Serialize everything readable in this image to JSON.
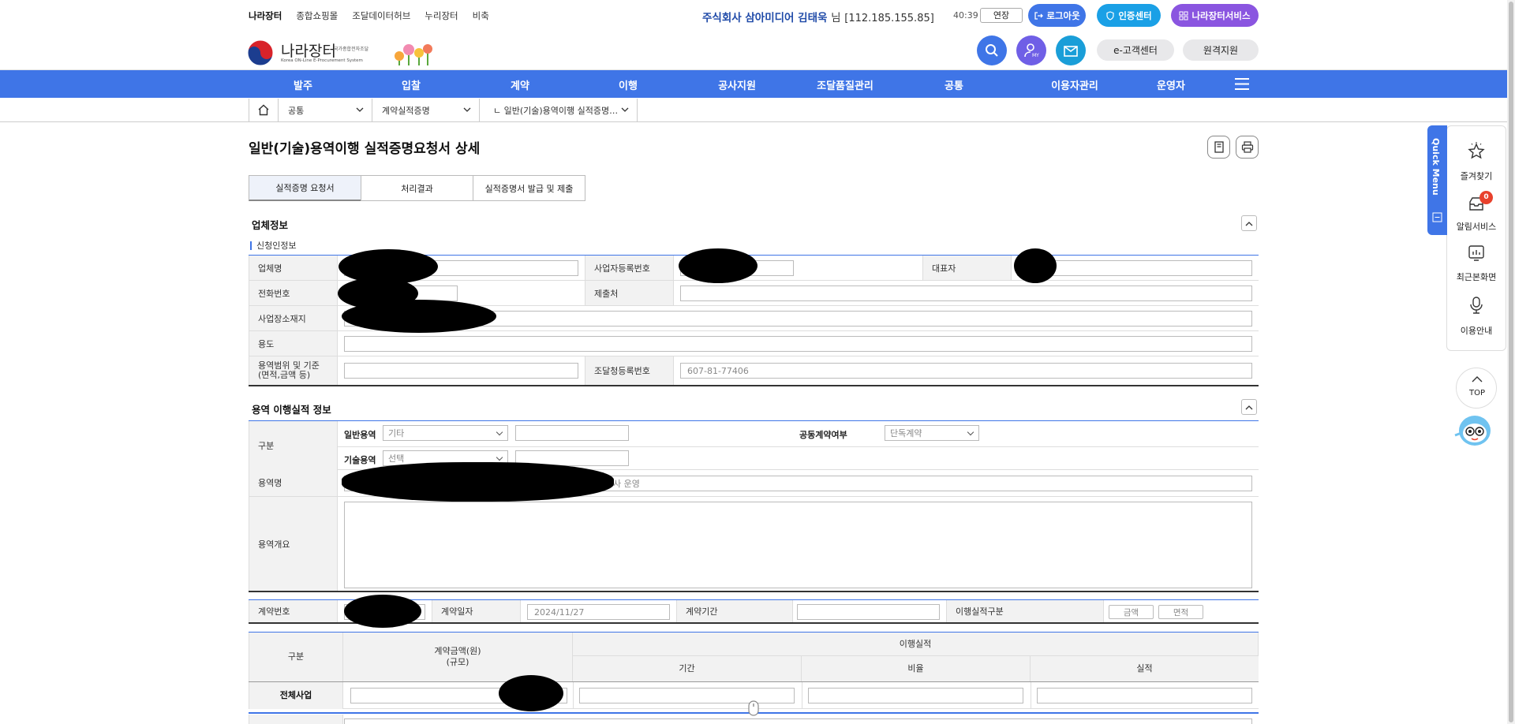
{
  "topnav": {
    "links": [
      "나라장터",
      "종합쇼핑몰",
      "조달데이터허브",
      "누리장터",
      "비축"
    ]
  },
  "user": {
    "company_name": "주식회사 삼아미디어 김태욱",
    "suffix": "님",
    "ip": "[112.185.155.85]",
    "timer": "40:39",
    "extend_label": "연장"
  },
  "top_buttons": {
    "logout": "로그아웃",
    "cert": "인증센터",
    "services": "나라장터서비스"
  },
  "logo": {
    "name": "나라장터",
    "sub_kr": "국가종합전자조달",
    "sub_en": "Korea ON-Line E-Procurement System"
  },
  "header_buttons": {
    "customer_center": "e-고객센터",
    "remote_support": "원격지원"
  },
  "gnb": [
    "발주",
    "입찰",
    "계약",
    "이행",
    "공사지원",
    "조달품질관리",
    "공통",
    "이용자관리",
    "운영자"
  ],
  "breadcrumb": {
    "level1": "공통",
    "level2": "계약실적증명",
    "level3": "ㄴ 일반(기술)용역이행 실적증명…"
  },
  "page_title": "일반(기술)용역이행 실적증명요청서 상세",
  "tabs": [
    "실적증명 요청서",
    "처리결과",
    "실적증명서 발급 및 제출"
  ],
  "company_section": {
    "title": "업체정보",
    "subtitle": "신청인정보",
    "labels": {
      "company": "업체명",
      "biz_no": "사업자등록번호",
      "ceo": "대표자",
      "phone": "전화번호",
      "submit_to": "제출처",
      "address": "사업장소재지",
      "purpose": "용도",
      "scope": "용역범위 및 기준",
      "scope2": "(면적,금액 등)",
      "reg_no": "조달청등록번호"
    },
    "values": {
      "reg_no": "607-81-77406"
    }
  },
  "service_section": {
    "title": "용역 이행실적 정보",
    "labels": {
      "category": "구분",
      "general": "일반용역",
      "technical": "기술용역",
      "joint": "공동계약여부",
      "name": "용역명",
      "overview": "용역개요",
      "contract_no": "계약번호",
      "contract_date": "계약일자",
      "contract_period": "계약기간",
      "perf_type": "이행실적구분"
    },
    "values": {
      "general_select": "기타",
      "technical_select": "선택",
      "joint_select": "단독계약",
      "name_suffix": "사 운영",
      "contract_date": "2024/11/27",
      "perf_btn1": "금액",
      "perf_btn2": "면적"
    }
  },
  "table": {
    "col_category": "구분",
    "col_amount": "계약금액(원)",
    "col_amount2": "(규모)",
    "col_perf": "이행실적",
    "col_period": "기간",
    "col_ratio": "비율",
    "col_result": "실적",
    "row_total": "전체사업"
  },
  "quick_menu": {
    "title": "Quick Menu",
    "items": [
      "즐겨찾기",
      "알림서비스",
      "최근본화면",
      "이용안내"
    ],
    "badge": "0",
    "top": "TOP"
  }
}
